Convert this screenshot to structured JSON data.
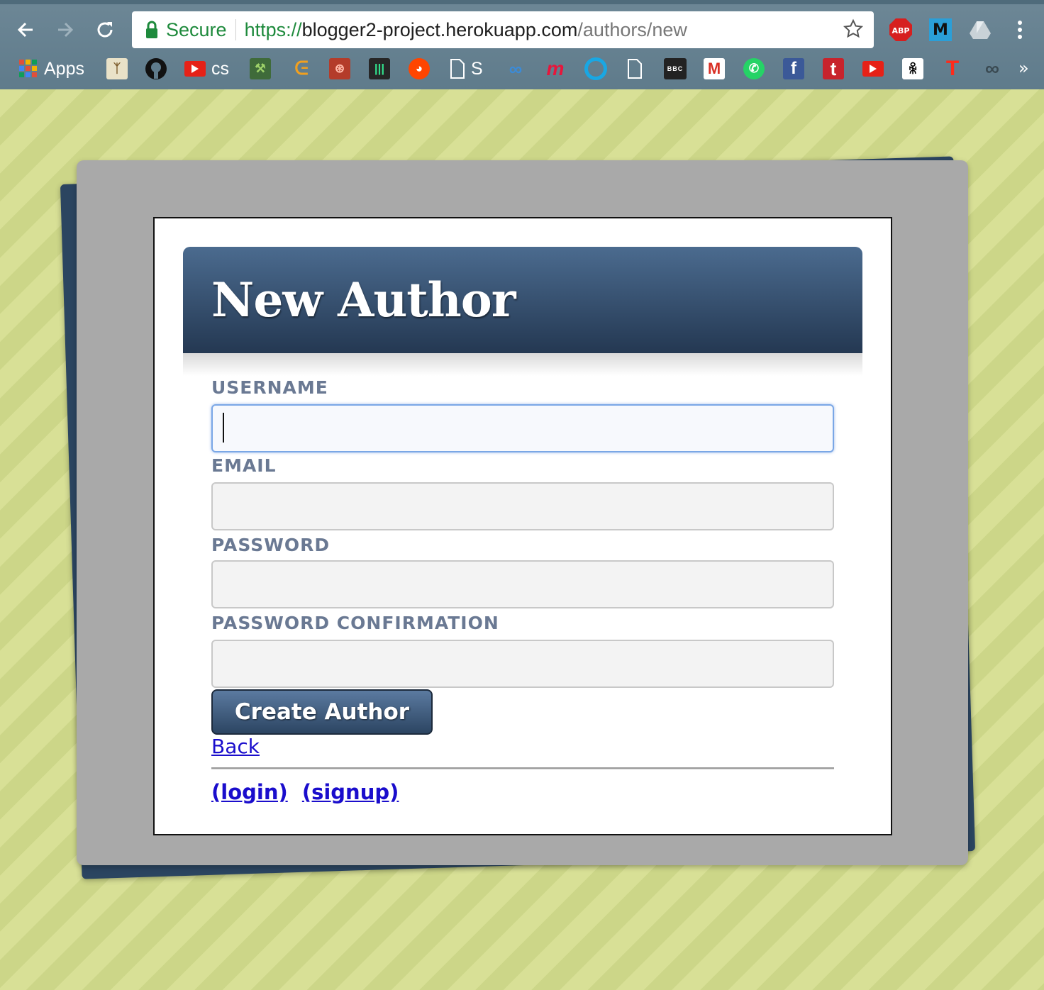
{
  "browser": {
    "secure_label": "Secure",
    "url_scheme": "https://",
    "url_host": "blogger2-project.herokuapp.com",
    "url_path": "/authors/new",
    "bookmarks": {
      "apps": "Apps",
      "cs": "cs",
      "s": "S",
      "bbc": "BBC"
    },
    "extensions": {
      "abp": "ABP",
      "m": "M"
    },
    "overflow": "»"
  },
  "page": {
    "title": "New Author",
    "form": {
      "username_label": "USERNAME",
      "username_value": "",
      "email_label": "EMAIL",
      "email_value": "",
      "password_label": "PASSWORD",
      "password_value": "",
      "password_confirmation_label": "PASSWORD CONFIRMATION",
      "password_confirmation_value": "",
      "submit_label": "Create Author"
    },
    "back_link": "Back",
    "login_link": "(login)",
    "signup_link": "(signup)"
  },
  "colors": {
    "background": "#d8e096",
    "banner": "#2f4a68",
    "label": "#6a7993",
    "link": "#1a0dcc",
    "secure_green": "#1e8a3c"
  }
}
